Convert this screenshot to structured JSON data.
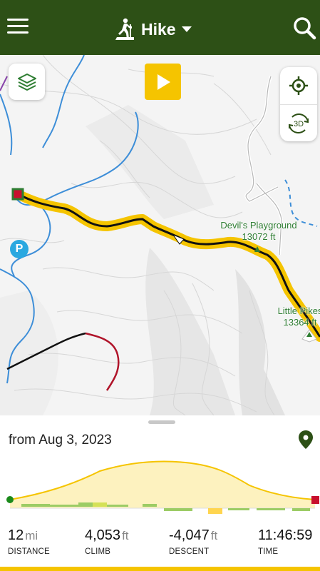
{
  "header": {
    "activity": "Hike",
    "menu_icon": "hamburger-menu-icon",
    "activity_icon": "hiker-icon",
    "search_icon": "search-icon",
    "bg_color": "#2d5016"
  },
  "map": {
    "layers_icon": "layers-icon",
    "play_icon": "play-icon",
    "location_icon": "crosshair-icon",
    "three_d_label": "3D",
    "parking_label": "P",
    "peaks": [
      {
        "name": "Devil's Playground",
        "elevation": "13072 ft"
      },
      {
        "name": "Little Pikes",
        "elevation": "13364 ft"
      }
    ],
    "track_color": "#f5c400",
    "line_color": "#111111"
  },
  "panel": {
    "date": "from Aug 3, 2023",
    "pin_icon": "location-pin-icon",
    "stats": [
      {
        "value": "12",
        "unit": "mi",
        "label": "DISTANCE"
      },
      {
        "value": "4,053",
        "unit": "ft",
        "label": "CLIMB"
      },
      {
        "value": "-4,047",
        "unit": "ft",
        "label": "DESCENT"
      },
      {
        "value": "11:46:59",
        "unit": "",
        "label": "TIME"
      }
    ]
  }
}
